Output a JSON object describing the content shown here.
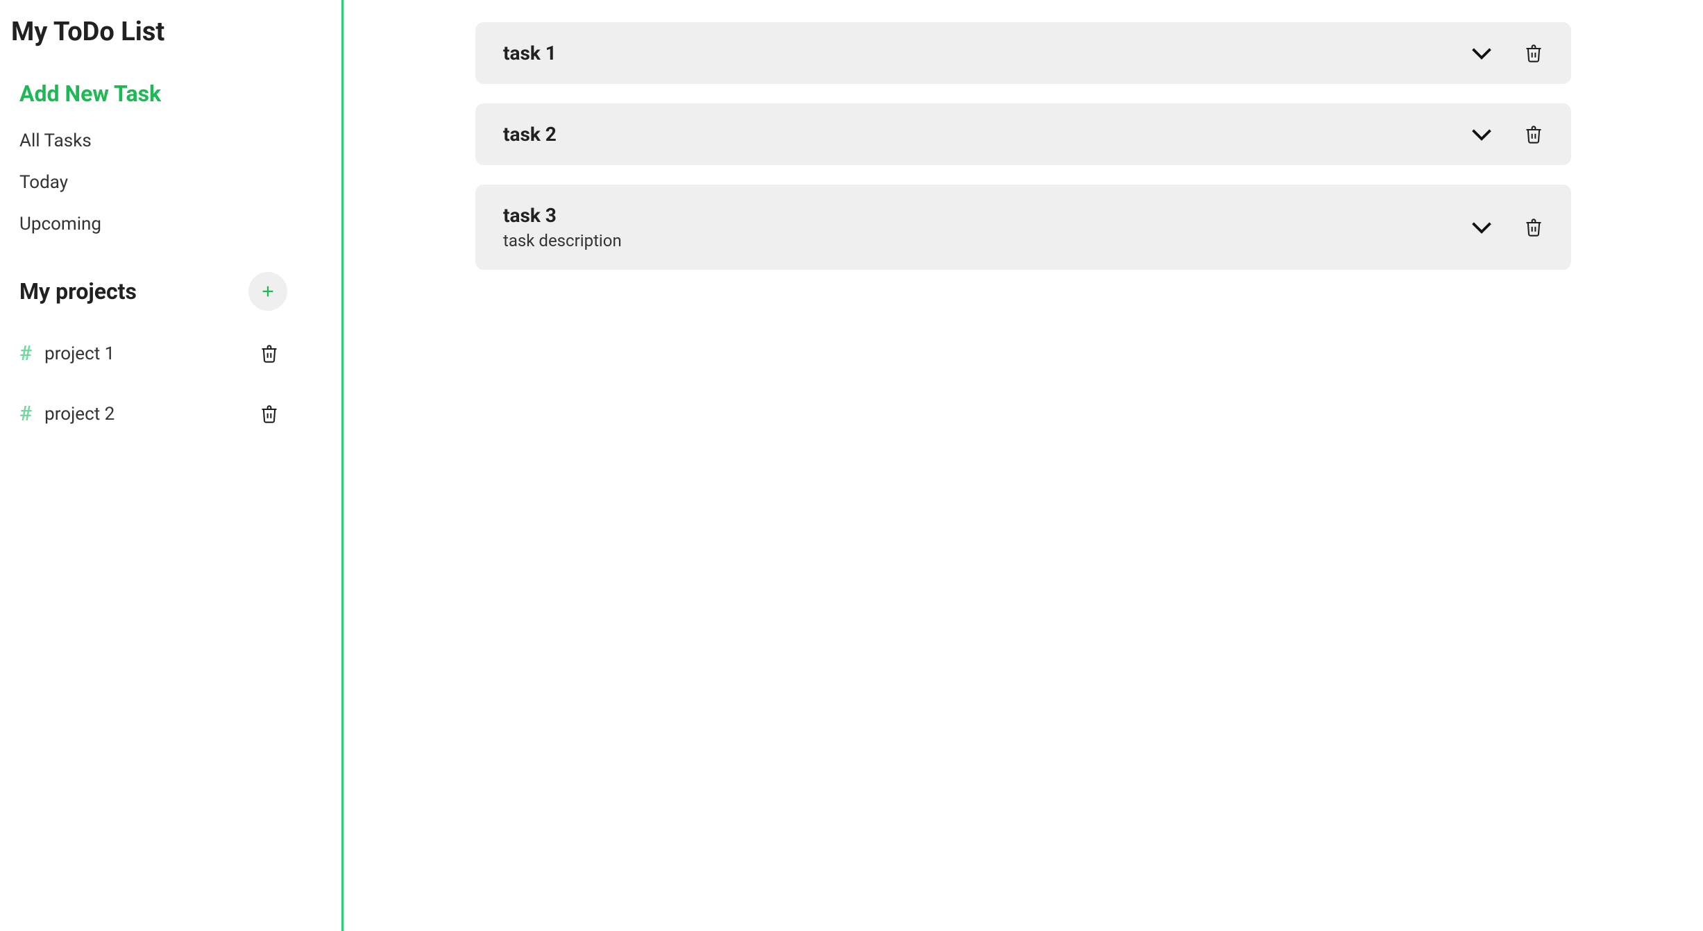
{
  "app_title": "My ToDo List",
  "nav": {
    "add_task": "Add New Task",
    "all_tasks": "All Tasks",
    "today": "Today",
    "upcoming": "Upcoming"
  },
  "projects_header": {
    "title": "My projects"
  },
  "projects": [
    {
      "name": "project 1"
    },
    {
      "name": "project 2"
    }
  ],
  "tasks": [
    {
      "title": "task 1",
      "description": ""
    },
    {
      "title": "task 2",
      "description": ""
    },
    {
      "title": "task 3",
      "description": "task description"
    }
  ]
}
